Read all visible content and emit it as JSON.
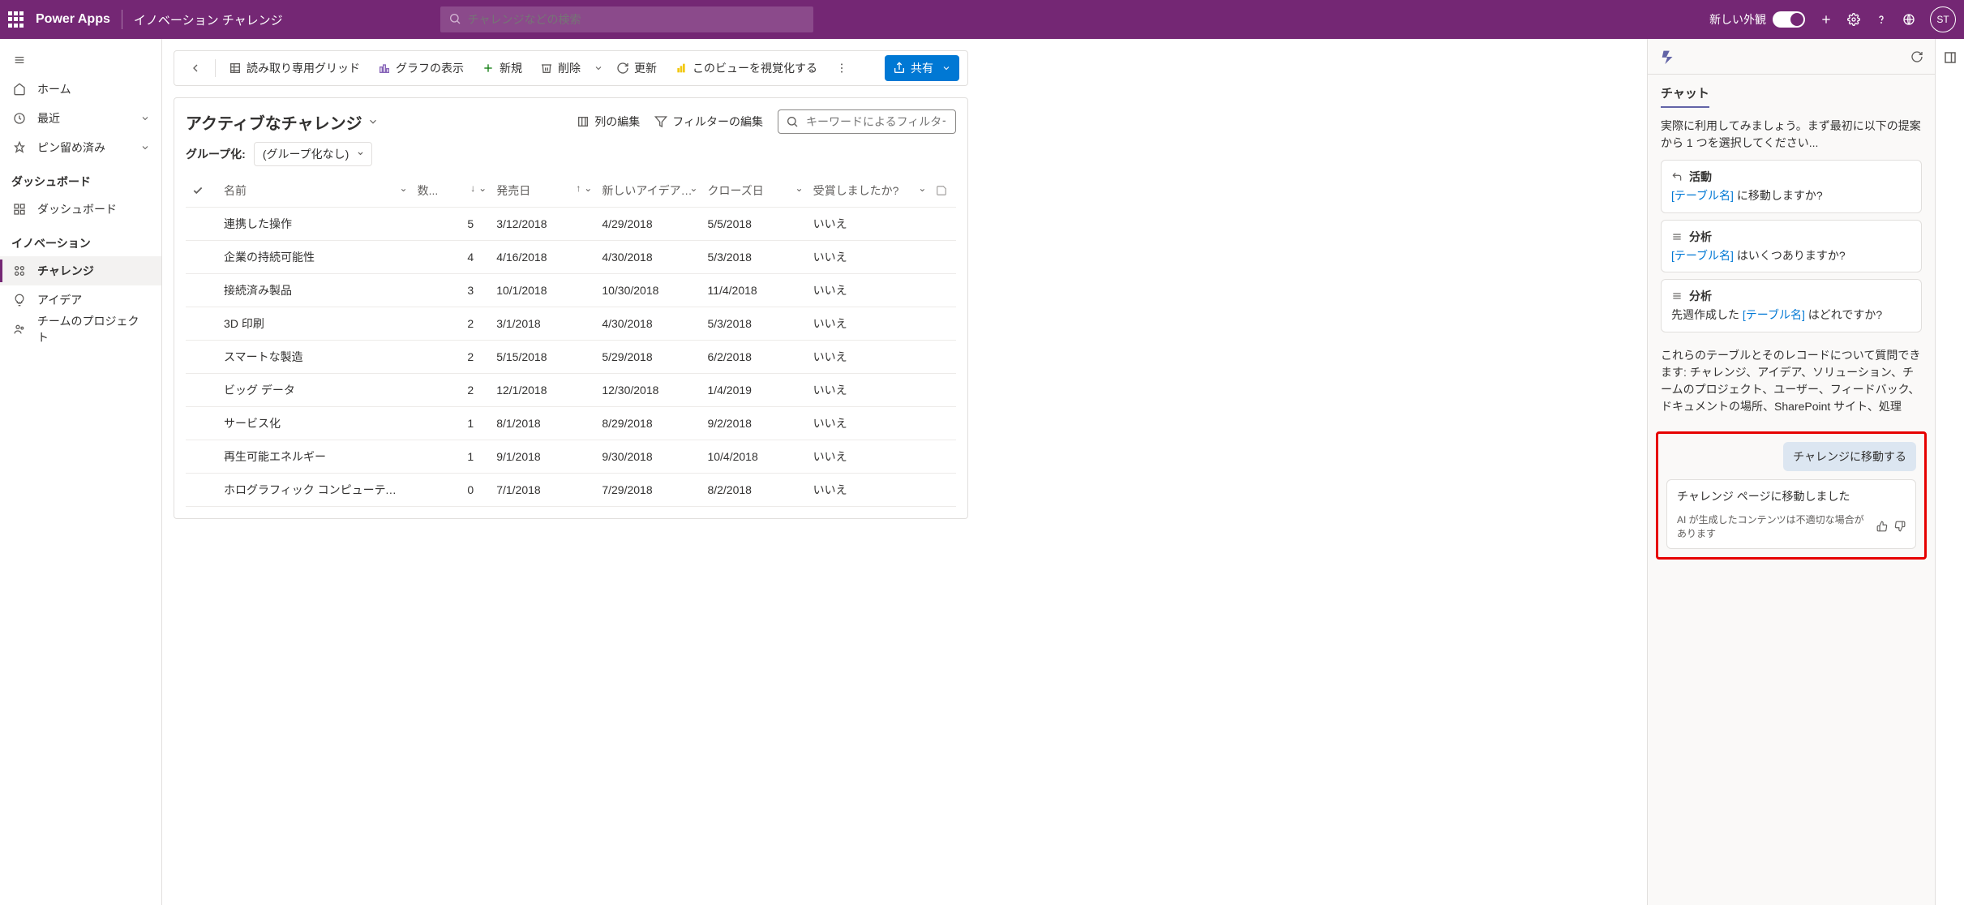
{
  "ribbon": {
    "brand": "Power Apps",
    "env": "イノベーション チャレンジ",
    "search_placeholder": "チャレンジなどの検索",
    "new_look": "新しい外観",
    "avatar_initials": "ST"
  },
  "sidebar": {
    "items": [
      {
        "icon": "home",
        "label": "ホーム"
      },
      {
        "icon": "clock",
        "label": "最近",
        "expandable": true
      },
      {
        "icon": "pin",
        "label": "ピン留め済み",
        "expandable": true
      }
    ],
    "sections": [
      {
        "heading": "ダッシュボード",
        "items": [
          {
            "icon": "dashboard",
            "label": "ダッシュボード"
          }
        ]
      },
      {
        "heading": "イノベーション",
        "items": [
          {
            "icon": "challenge",
            "label": "チャレンジ",
            "active": true
          },
          {
            "icon": "idea",
            "label": "アイデア"
          },
          {
            "icon": "team",
            "label": "チームのプロジェクト"
          }
        ]
      }
    ]
  },
  "cmdbar": {
    "readonly_grid": "読み取り専用グリッド",
    "show_chart": "グラフの表示",
    "new": "新規",
    "delete": "削除",
    "refresh": "更新",
    "visualize": "このビューを視覚化する",
    "share": "共有"
  },
  "view": {
    "title": "アクティブなチャレンジ",
    "edit_columns": "列の編集",
    "edit_filters": "フィルターの編集",
    "filter_placeholder": "キーワードによるフィルター",
    "group_by_label": "グループ化:",
    "group_by_value": "(グループ化なし)"
  },
  "grid": {
    "columns": [
      "名前",
      "数...",
      "発売日",
      "新しいアイデアを承認...",
      "クローズ日",
      "受賞しましたか?"
    ],
    "rows": [
      {
        "name": "連携した操作",
        "count": 5,
        "launch": "3/12/2018",
        "approve": "4/29/2018",
        "close": "5/5/2018",
        "won": "いいえ"
      },
      {
        "name": "企業の持続可能性",
        "count": 4,
        "launch": "4/16/2018",
        "approve": "4/30/2018",
        "close": "5/3/2018",
        "won": "いいえ"
      },
      {
        "name": "接続済み製品",
        "count": 3,
        "launch": "10/1/2018",
        "approve": "10/30/2018",
        "close": "11/4/2018",
        "won": "いいえ"
      },
      {
        "name": "3D 印刷",
        "count": 2,
        "launch": "3/1/2018",
        "approve": "4/30/2018",
        "close": "5/3/2018",
        "won": "いいえ"
      },
      {
        "name": "スマートな製造",
        "count": 2,
        "launch": "5/15/2018",
        "approve": "5/29/2018",
        "close": "6/2/2018",
        "won": "いいえ"
      },
      {
        "name": "ビッグ データ",
        "count": 2,
        "launch": "12/1/2018",
        "approve": "12/30/2018",
        "close": "1/4/2019",
        "won": "いいえ"
      },
      {
        "name": "サービス化",
        "count": 1,
        "launch": "8/1/2018",
        "approve": "8/29/2018",
        "close": "9/2/2018",
        "won": "いいえ"
      },
      {
        "name": "再生可能エネルギー",
        "count": 1,
        "launch": "9/1/2018",
        "approve": "9/30/2018",
        "close": "10/4/2018",
        "won": "いいえ"
      },
      {
        "name": "ホログラフィック コンピューティング",
        "count": 0,
        "launch": "7/1/2018",
        "approve": "7/29/2018",
        "close": "8/2/2018",
        "won": "いいえ"
      }
    ]
  },
  "copilot": {
    "tab": "チャット",
    "intro": "実際に利用してみましょう。まず最初に以下の提案から 1 つを選択してください...",
    "cards": [
      {
        "head": "活動",
        "body_pre": "",
        "link": "[テーブル名]",
        "body_post": " に移動しますか?"
      },
      {
        "head": "分析",
        "body_pre": "",
        "link": "[テーブル名]",
        "body_post": " はいくつありますか?"
      },
      {
        "head": "分析",
        "body_pre": "先週作成した ",
        "link": "[テーブル名]",
        "body_post": " はどれですか?"
      }
    ],
    "footer_note": "これらのテーブルとそのレコードについて質問できます: チャレンジ、アイデア、ソリューション、チームのプロジェクト、ユーザー、フィードバック、ドキュメントの場所、SharePoint サイト、処理",
    "user_msg": "チャレンジに移動する",
    "ai_msg": "チャレンジ ページに移動しました",
    "disclaimer": "AI が生成したコンテンツは不適切な場合があります"
  }
}
